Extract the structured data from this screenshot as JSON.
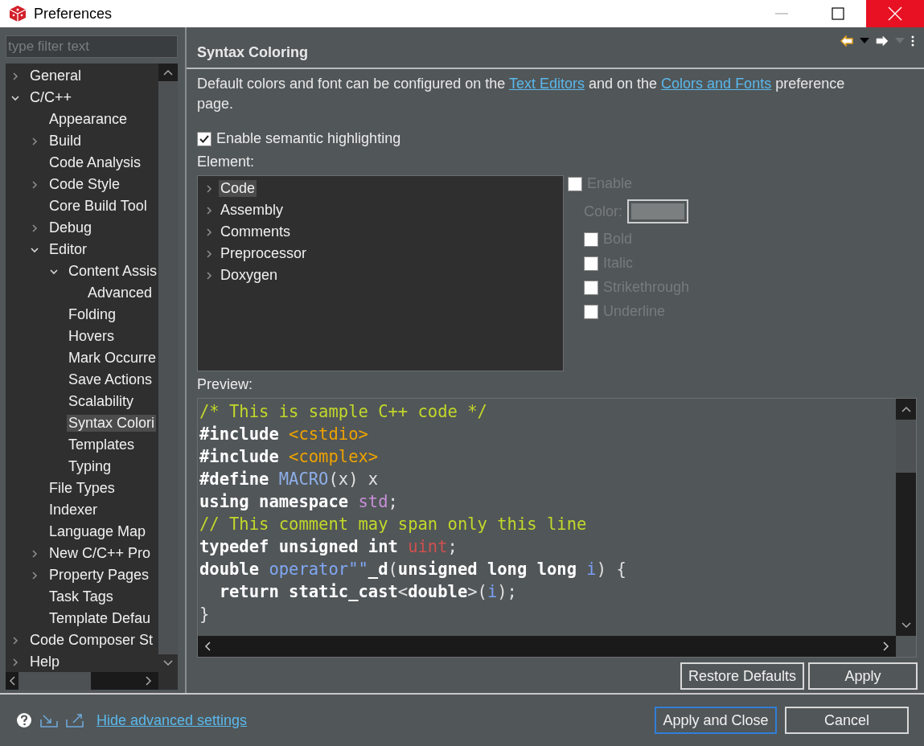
{
  "window": {
    "title": "Preferences"
  },
  "filter": {
    "placeholder": "type filter text"
  },
  "tree": [
    {
      "label": "General",
      "expanded": false,
      "selected": false
    },
    {
      "label": "C/C++",
      "expanded": true,
      "selected": false,
      "children": [
        {
          "label": "Appearance",
          "selected": false
        },
        {
          "label": "Build",
          "expanded": false,
          "selected": false
        },
        {
          "label": "Code Analysis",
          "selected": false
        },
        {
          "label": "Code Style",
          "expanded": false,
          "selected": false
        },
        {
          "label": "Core Build Tool",
          "selected": false
        },
        {
          "label": "Debug",
          "expanded": false,
          "selected": false
        },
        {
          "label": "Editor",
          "expanded": true,
          "selected": false,
          "children": [
            {
              "label": "Content Assis",
              "expanded": true,
              "selected": false,
              "children": [
                {
                  "label": "Advanced",
                  "selected": false
                }
              ]
            },
            {
              "label": "Folding",
              "selected": false
            },
            {
              "label": "Hovers",
              "selected": false
            },
            {
              "label": "Mark Occurre",
              "selected": false
            },
            {
              "label": "Save Actions",
              "selected": false
            },
            {
              "label": "Scalability",
              "selected": false
            },
            {
              "label": "Syntax Colori",
              "selected": true
            },
            {
              "label": "Templates",
              "selected": false
            },
            {
              "label": "Typing",
              "selected": false
            }
          ]
        },
        {
          "label": "File Types",
          "selected": false
        },
        {
          "label": "Indexer",
          "selected": false
        },
        {
          "label": "Language Map",
          "selected": false
        },
        {
          "label": "New C/C++ Pro",
          "expanded": false,
          "selected": false
        },
        {
          "label": "Property Pages",
          "expanded": false,
          "selected": false
        },
        {
          "label": "Task Tags",
          "selected": false
        },
        {
          "label": "Template Defau",
          "selected": false
        }
      ]
    },
    {
      "label": "Code Composer St",
      "expanded": false,
      "selected": false
    },
    {
      "label": "Help",
      "expanded": false,
      "selected": false
    }
  ],
  "page": {
    "title": "Syntax Coloring",
    "description": [
      "Default colors and font can be configured on the ",
      {
        "link": "Text Editors"
      },
      " and on the ",
      {
        "link": "Colors and Fonts"
      },
      " preference page."
    ],
    "semantic": {
      "label": "Enable semantic highlighting",
      "checked": true
    },
    "element_label": "Element:",
    "elements": [
      {
        "label": "Code",
        "selected": true
      },
      {
        "label": "Assembly",
        "selected": false
      },
      {
        "label": "Comments",
        "selected": false
      },
      {
        "label": "Preprocessor",
        "selected": false
      },
      {
        "label": "Doxygen",
        "selected": false
      }
    ],
    "enable": {
      "label": "Enable",
      "checked": false,
      "disabled": true
    },
    "color_label": "Color:",
    "styles": [
      {
        "label": "Bold",
        "checked": false,
        "disabled": true
      },
      {
        "label": "Italic",
        "checked": false,
        "disabled": true
      },
      {
        "label": "Strikethrough",
        "checked": false,
        "disabled": true
      },
      {
        "label": "Underline",
        "checked": false,
        "disabled": true
      }
    ],
    "preview_label": "Preview:",
    "preview": [
      [
        {
          "text": "/* This is sample C++ code */",
          "color": "#c2d82a",
          "bold": false
        }
      ],
      [
        {
          "text": "#include ",
          "color": "#ffffff",
          "bold": true
        },
        {
          "text": "<cstdio>",
          "color": "#eda200",
          "bold": false
        }
      ],
      [
        {
          "text": "#include ",
          "color": "#ffffff",
          "bold": true
        },
        {
          "text": "<complex>",
          "color": "#eda200",
          "bold": false
        }
      ],
      [
        {
          "text": "#define ",
          "color": "#ffffff",
          "bold": true
        },
        {
          "text": "MACRO",
          "color": "#8eaee9",
          "bold": false
        },
        {
          "text": "(x) x",
          "color": "#e0e0e0",
          "bold": false
        }
      ],
      [
        {
          "text": "using namespace ",
          "color": "#ffffff",
          "bold": true
        },
        {
          "text": "std",
          "color": "#c58fd6",
          "bold": false
        },
        {
          "text": ";",
          "color": "#e0e0e0",
          "bold": false
        }
      ],
      [
        {
          "text": "// This comment may span only this line",
          "color": "#c2d82a",
          "bold": false
        }
      ],
      [
        {
          "text": "typedef unsigned int ",
          "color": "#ffffff",
          "bold": true
        },
        {
          "text": "uint",
          "color": "#d05050",
          "bold": false
        },
        {
          "text": ";",
          "color": "#e0e0e0",
          "bold": false
        }
      ],
      [
        {
          "text": "double ",
          "color": "#ffffff",
          "bold": true
        },
        {
          "text": "operator\"\"",
          "color": "#80a8f4",
          "bold": false
        },
        {
          "text": "_d",
          "color": "#ffffff",
          "bold": true
        },
        {
          "text": "(",
          "color": "#e0e0e0",
          "bold": false
        },
        {
          "text": "unsigned long long ",
          "color": "#ffffff",
          "bold": true
        },
        {
          "text": "i",
          "color": "#7a9ef4",
          "bold": false
        },
        {
          "text": ") {",
          "color": "#e0e0e0",
          "bold": false
        }
      ],
      [
        {
          "text": "  return static_cast",
          "color": "#ffffff",
          "bold": true
        },
        {
          "text": "<",
          "color": "#e0e0e0",
          "bold": false
        },
        {
          "text": "double",
          "color": "#ffffff",
          "bold": true
        },
        {
          "text": ">(",
          "color": "#e0e0e0",
          "bold": false
        },
        {
          "text": "i",
          "color": "#7a9ef4",
          "bold": false
        },
        {
          "text": ");",
          "color": "#e0e0e0",
          "bold": false
        }
      ],
      [
        {
          "text": "}",
          "color": "#e0e0e0",
          "bold": false
        }
      ]
    ],
    "buttons": [
      "Restore Defaults",
      "Apply"
    ]
  },
  "footer": {
    "link": "Hide advanced settings",
    "buttons": [
      {
        "label": "Apply and Close",
        "default": true
      },
      {
        "label": "Cancel",
        "default": false
      }
    ]
  }
}
